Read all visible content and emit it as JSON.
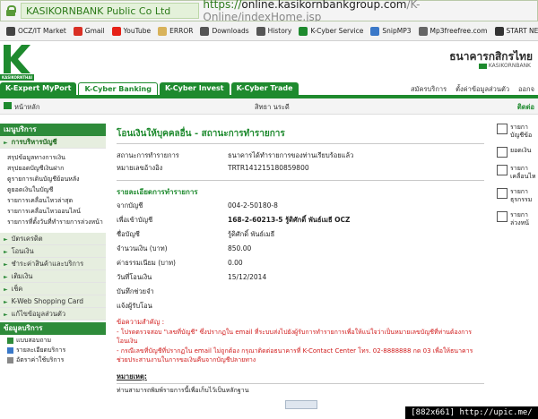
{
  "browser": {
    "site_badge": "KASIKORNBANK Public Co Ltd [TH]",
    "url_scheme": "https://",
    "url_host": "online.kasikornbankgroup.com",
    "url_path": "/K-Online/indexHome.jsp",
    "bookmarks": [
      {
        "label": "OCZ/IT Market",
        "icon": "ocz-icon",
        "color": "#444444"
      },
      {
        "label": "Gmail",
        "icon": "gmail-icon",
        "color": "#d93025"
      },
      {
        "label": "YouTube",
        "icon": "youtube-icon",
        "color": "#e62117"
      },
      {
        "label": "ERROR",
        "icon": "folder-icon",
        "color": "#d8b25a"
      },
      {
        "label": "Downloads",
        "icon": "download-icon",
        "color": "#555555"
      },
      {
        "label": "History",
        "icon": "history-icon",
        "color": "#555555"
      },
      {
        "label": "K-Cyber Service",
        "icon": "kbank-icon",
        "color": "#1e8a2e"
      },
      {
        "label": "SnipMP3",
        "icon": "snipmp3-icon",
        "color": "#3a78c8"
      },
      {
        "label": "Mp3freefree.com",
        "icon": "mp3-icon",
        "color": "#666666"
      },
      {
        "label": "START NET 3BB",
        "icon": "3bb-icon",
        "color": "#333333"
      }
    ]
  },
  "header": {
    "logo_caption": "KASIKORNTHAI",
    "bank_name_th": "ธนาคารกสิกรไทย",
    "bank_name_en": "KASIKORNBANK",
    "tabs": [
      {
        "label": "K-Expert MyPort",
        "active": false
      },
      {
        "label": "K-Cyber Banking",
        "active": true
      },
      {
        "label": "K-Cyber Invest",
        "active": false
      },
      {
        "label": "K-Cyber Trade",
        "active": false
      }
    ],
    "links": [
      "สมัครบริการ",
      "ตั้งค่าข้อมูลส่วนตัว",
      "ออกจ"
    ],
    "home_label": "หน้าหลัก",
    "user_name": "สิทธา นระดี",
    "contact_label": "ติดต่อ"
  },
  "sidebar": {
    "menu_title": "เมนูบริการ",
    "account_section": "การบริหารบัญชี",
    "account_items": [
      "สรุปข้อมูลทางการเงิน",
      "สรุปยอดบัญชีเงินฝาก",
      "ดูรายการเดินบัญชีย้อนหลัง",
      "ดูยอดเงินในบัญชี",
      "รายการเคลื่อนไหวล่าสุด",
      "รายการเคลื่อนไหวออนไลน์",
      "รายการที่ตั้งวันที่ทำรายการล่วงหน้า"
    ],
    "sections": [
      "บัตรเครดิต",
      "โอนเงิน",
      "ชำระค่าสินค้าและบริการ",
      "เติมเงิน",
      "เช็ค",
      "K-Web Shopping Card",
      "แก้ไขข้อมูลส่วนตัว"
    ],
    "service_title": "ข้อมูลบริการ",
    "service_items": [
      "แบบสอบถาม",
      "รายละเอียดบริการ",
      "อัตราค่าใช้บริการ"
    ]
  },
  "main": {
    "title": "โอนเงินให้บุคคลอื่น - สถานะการทำรายการ",
    "status_label": "สถานะการทำรายการ",
    "status_value": "ธนาคารได้ทำรายการของท่านเรียบร้อยแล้ว",
    "ref_label": "หมายเลขอ้างอิง",
    "ref_value": "TRTR141215180859800",
    "details_title": "รายละเอียดการทำรายการ",
    "fields": [
      {
        "label": "จากบัญชี",
        "value": "004-2-50180-8",
        "bold": false
      },
      {
        "label": "เพื่อเข้าบัญชี",
        "value": "168-2-60213-5 รู้ดิศักดิ์ พันธ์เมธี OCZ",
        "bold": true
      },
      {
        "label": "ชื่อบัญชี",
        "value": "รู้ดิศักดิ์ พันธ์เมธี",
        "bold": false
      },
      {
        "label": "จำนวนเงิน (บาท)",
        "value": "850.00",
        "bold": false
      },
      {
        "label": "ค่าธรรมเนียม (บาท)",
        "value": "0.00",
        "bold": false
      },
      {
        "label": "วันที่โอนเงิน",
        "value": "15/12/2014",
        "bold": false
      },
      {
        "label": "บันทึกช่วยจำ",
        "value": "",
        "bold": false
      },
      {
        "label": "แจ้งผู้รับโอน",
        "value": "",
        "bold": false
      }
    ],
    "notice_title": "ข้อความสำคัญ :",
    "notice_1": "- โปรดตรวจสอบ \"เลขที่บัญชี\" ซึ่งปรากฏใน email ที่ระบบส่งไปยังผู้รับการทำรายการเพื่อให้แน่ใจว่าเป็นหมายเลขบัญชีที่ท่านต้องการโอนเงิน",
    "notice_2": "- กรณีเลขที่บัญชีที่ปรากฏใน email ไม่ถูกต้อง กรุณาติดต่อธนาคารที่ K-Contact Center โทร. 02-8888888 กด 03 เพื่อให้ธนาคารช่วยประสานงานในการขอเงินคืนจากบัญชีปลายทาง",
    "note_head": "หมายเหตุ:",
    "note_text": "ท่านสามารถพิมพ์รายการนี้เพื่อเก็บไว้เป็นหลักฐาน"
  },
  "right_panel": [
    {
      "line1": "รายกา",
      "line2": "บัญชีข้อ"
    },
    {
      "line1": "ยอดเงิน",
      "line2": ""
    },
    {
      "line1": "รายกา",
      "line2": "เคลื่อนไห"
    },
    {
      "line1": "รายกา",
      "line2": "ธุรกรรม"
    },
    {
      "line1": "รายกา",
      "line2": "ล่วงหน้"
    }
  ],
  "watermark": "[882x661] http://upic.me/"
}
